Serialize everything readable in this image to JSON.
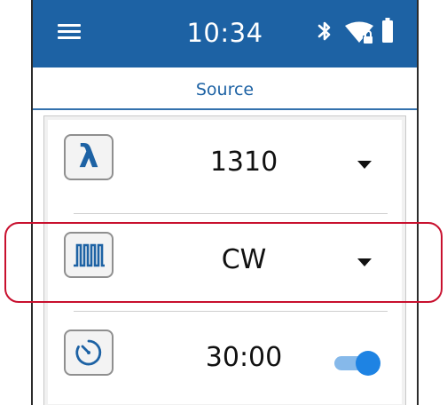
{
  "statusbar": {
    "time": "10:34",
    "icons": [
      "menu-icon",
      "bluetooth-icon",
      "wifi-lock-icon",
      "battery-icon"
    ],
    "background": "#1d62a4"
  },
  "tab": {
    "label": "Source"
  },
  "rows": [
    {
      "icon": "wavelength-lambda-icon",
      "icon_text": "λ",
      "value": "1310",
      "control": "dropdown"
    },
    {
      "icon": "pulse-waveform-icon",
      "value": "CW",
      "control": "dropdown",
      "highlighted": true
    },
    {
      "icon": "timer-icon",
      "value": "30:00",
      "control": "toggle",
      "toggle_on": true
    }
  ],
  "colors": {
    "accent": "#1d62a4",
    "highlight": "#c8102e",
    "toggle_on": "#1e83e3"
  }
}
